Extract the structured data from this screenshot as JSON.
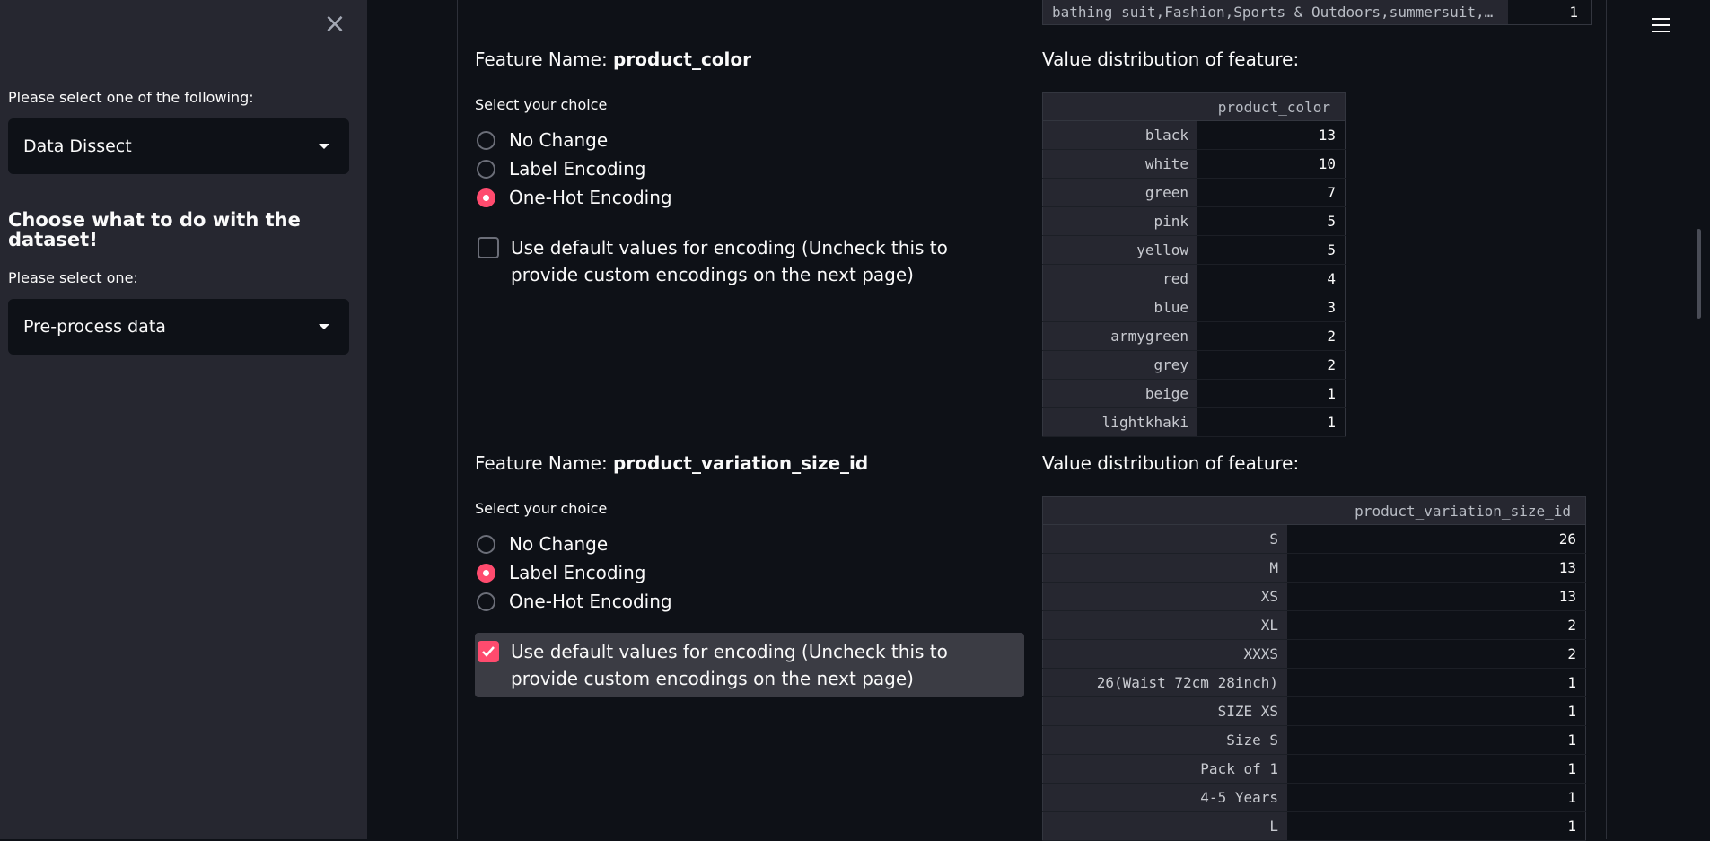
{
  "sidebar": {
    "close_icon": "×",
    "label_1": "Please select one of the following:",
    "select_1": "Data Dissect",
    "heading": "Choose what to do with the dataset!",
    "label_2": "Please select one:",
    "select_2": "Pre-process data"
  },
  "top_row": {
    "index": "bathing suit,Fashion,Sports & Outdoors,summersuit,…",
    "value": "1"
  },
  "features": [
    {
      "name_prefix": "Feature Name:",
      "name": "product_color",
      "choice_label": "Select your choice",
      "options": [
        "No Change",
        "Label Encoding",
        "One-Hot Encoding"
      ],
      "selected": "One-Hot Encoding",
      "default_checkbox": "Use default values for encoding (Uncheck this to provide custom encodings on the next page)",
      "default_checked": false,
      "dist_title": "Value distribution of feature:",
      "column": "product_color",
      "rows": [
        [
          "black",
          "13"
        ],
        [
          "white",
          "10"
        ],
        [
          "green",
          "7"
        ],
        [
          "pink",
          "5"
        ],
        [
          "yellow",
          "5"
        ],
        [
          "red",
          "4"
        ],
        [
          "blue",
          "3"
        ],
        [
          "armygreen",
          "2"
        ],
        [
          "grey",
          "2"
        ],
        [
          "beige",
          "1"
        ],
        [
          "lightkhaki",
          "1"
        ]
      ]
    },
    {
      "name_prefix": "Feature Name:",
      "name": "product_variation_size_id",
      "choice_label": "Select your choice",
      "options": [
        "No Change",
        "Label Encoding",
        "One-Hot Encoding"
      ],
      "selected": "Label Encoding",
      "default_checkbox": "Use default values for encoding (Uncheck this to provide custom encodings on the next page)",
      "default_checked": true,
      "dist_title": "Value distribution of feature:",
      "column": "product_variation_size_id",
      "rows": [
        [
          "S",
          "26"
        ],
        [
          "M",
          "13"
        ],
        [
          "XS",
          "13"
        ],
        [
          "XL",
          "2"
        ],
        [
          "XXXS",
          "2"
        ],
        [
          "26(Waist 72cm 28inch)",
          "1"
        ],
        [
          "SIZE XS",
          "1"
        ],
        [
          "Size S",
          "1"
        ],
        [
          "Pack of 1",
          "1"
        ],
        [
          "4-5 Years",
          "1"
        ],
        [
          "L",
          "1"
        ]
      ]
    }
  ]
}
